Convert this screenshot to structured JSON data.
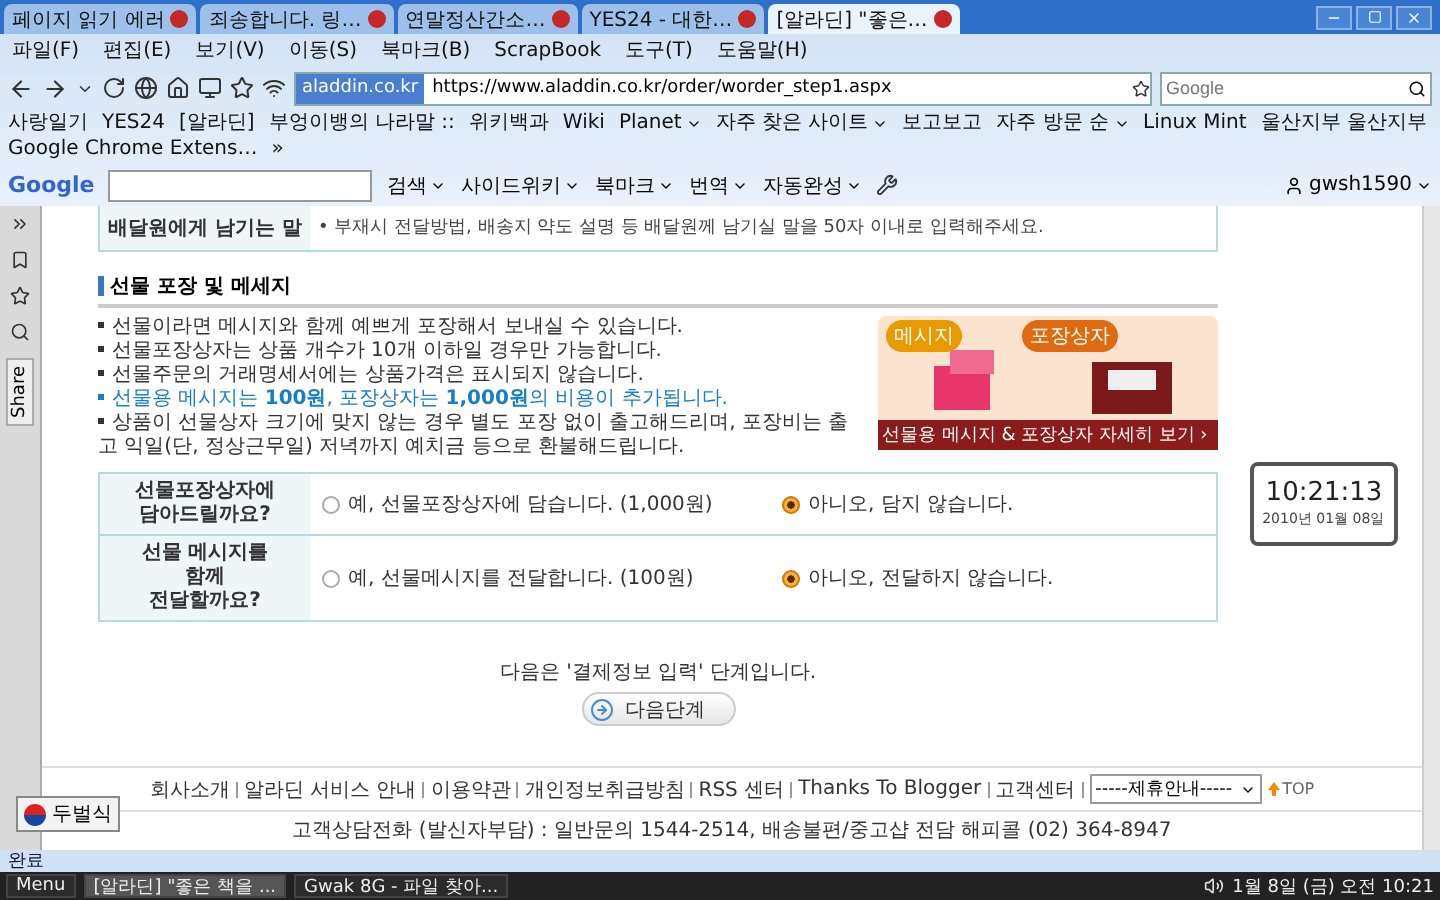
{
  "tabs": [
    {
      "label": "페이지 읽기 에러",
      "selected": false
    },
    {
      "label": "죄송합니다. 링…",
      "selected": false
    },
    {
      "label": "연말정산간소…",
      "selected": false
    },
    {
      "label": "YES24 - 대한…",
      "selected": false
    },
    {
      "label": "[알라딘] \"좋은…",
      "selected": true
    }
  ],
  "menu": [
    "파일(F)",
    "편집(E)",
    "보기(V)",
    "이동(S)",
    "북마크(B)",
    "ScrapBook",
    "도구(T)",
    "도움말(H)"
  ],
  "address": {
    "site": "aladdin.co.kr",
    "url": "https://www.aladdin.co.kr/order/worder_step1.aspx"
  },
  "search": {
    "placeholder": "Google"
  },
  "bookmarks": [
    {
      "label": "사랑일기",
      "menu": false
    },
    {
      "label": "YES24",
      "menu": false
    },
    {
      "label": "[알라딘]",
      "menu": false
    },
    {
      "label": "부엉이뱅의 나라말 ::",
      "menu": false
    },
    {
      "label": "위키백과",
      "menu": false
    },
    {
      "label": "Wiki",
      "menu": false
    },
    {
      "label": "Planet",
      "menu": true
    },
    {
      "label": "자주 찾은 사이트",
      "menu": true
    },
    {
      "label": "보고보고",
      "menu": false
    },
    {
      "label": "자주 방문 순",
      "menu": true
    },
    {
      "label": "Linux Mint",
      "menu": false
    },
    {
      "label": "울산지부 울산지부",
      "menu": false
    },
    {
      "label": "Google Chrome Extens…",
      "menu": false
    },
    {
      "label": "»",
      "menu": false
    }
  ],
  "google_toolbar": {
    "logo": "Google",
    "items": [
      {
        "label": "검색",
        "menu": true
      },
      {
        "label": "사이드위키",
        "menu": true
      },
      {
        "label": "북마크",
        "menu": true
      },
      {
        "label": "번역",
        "menu": true
      },
      {
        "label": "자동완성",
        "menu": true
      }
    ],
    "account": "gwsh1590"
  },
  "sidebar": {
    "tab": "Share"
  },
  "delivery_note": {
    "label": "배달원에게 남기는 말",
    "hint": "• 부재시 전달방법, 배송지 약도 설명 등 배달원께 남기실 말을 50자 이내로 입력해주세요."
  },
  "gift": {
    "title": "선물 포장 및 메세지",
    "bullets": [
      {
        "text": "선물이라면 메시지와 함께 예쁘게 포장해서 보내실 수 있습니다.",
        "highlight": false
      },
      {
        "text": "선물포장상자는 상품 개수가 10개 이하일 경우만 가능합니다.",
        "highlight": false
      },
      {
        "text": "선물주문의 거래명세서에는 상품가격은 표시되지 않습니다.",
        "highlight": false
      },
      {
        "text": "선물용 메시지는 **100원**, 포장상자는 **1,000원**의 비용이 추가됩니다.",
        "highlight": true
      },
      {
        "text": "상품이 선물상자 크기에 맞지 않는 경우 별도 포장 없이 출고해드리며, 포장비는 출고 익일(단, 정상근무일) 저녁까지 예치금 등으로 환불해드립니다.",
        "highlight": false
      }
    ],
    "promo": {
      "badge_message": "메시지",
      "badge_box": "포장상자",
      "link": "선물용 메시지 & 포장상자 자세히 보기 ›"
    },
    "questions": [
      {
        "label_lines": [
          "선물포장상자에",
          "담아드릴까요?"
        ],
        "options": [
          {
            "label": "예, 선물포장상자에 담습니다. (1,000원)",
            "selected": false
          },
          {
            "label": "아니오, 담지 않습니다.",
            "selected": true
          }
        ]
      },
      {
        "label_lines": [
          "선물 메시지를",
          "함께",
          "전달할까요?"
        ],
        "options": [
          {
            "label": "예, 선물메시지를 전달합니다. (100원)",
            "selected": false
          },
          {
            "label": "아니오, 전달하지 않습니다.",
            "selected": true
          }
        ]
      }
    ]
  },
  "next": {
    "text": "다음은 '결제정보 입력' 단계입니다.",
    "button": "다음단계"
  },
  "footer": {
    "links": [
      "회사소개",
      "알라딘 서비스 안내",
      "이용약관",
      "개인정보취급방침",
      "RSS 센터",
      "Thanks To Blogger",
      "고객센터"
    ],
    "select": "-----제휴안내-----",
    "top": "TOP",
    "contact": "고객상담전화 (발신자부담) : 일반문의 1544-2514, 배송불편/중고샵 전담 해피콜 (02) 364-8947"
  },
  "clock": {
    "time": "10:21:13",
    "date": "2010년 01월 08일"
  },
  "ime": {
    "label": "두벌식"
  },
  "status": "완료",
  "taskbar": {
    "menu": "Menu",
    "windows": [
      {
        "label": "[알라딘] \"좋은 책을 ...",
        "selected": true
      },
      {
        "label": "Gwak 8G - 파일 찾아...",
        "selected": false
      }
    ],
    "clock": "1월 8일 (금) 오전 10:21"
  }
}
